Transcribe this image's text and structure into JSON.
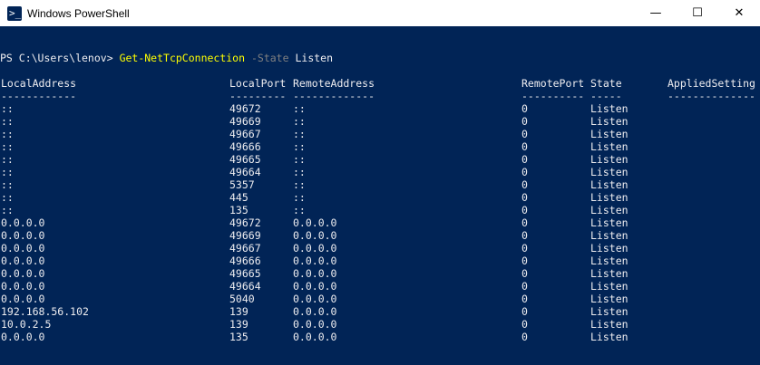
{
  "window": {
    "title": "Windows PowerShell",
    "icon_glyph": ">_",
    "minimize": "—",
    "maximize": "☐",
    "close": "✕"
  },
  "console": {
    "prompt": "PS C:\\Users\\lenov> ",
    "command": "Get-NetTcpConnection",
    "param": "-State",
    "value": "Listen",
    "headers": [
      "LocalAddress",
      "LocalPort",
      "RemoteAddress",
      "RemotePort",
      "State",
      "AppliedSetting"
    ],
    "underlines": [
      "------------",
      "---------",
      "-------------",
      "----------",
      "-----",
      "--------------"
    ],
    "rows": [
      [
        "::",
        "49672",
        "::",
        "0",
        "Listen",
        ""
      ],
      [
        "::",
        "49669",
        "::",
        "0",
        "Listen",
        ""
      ],
      [
        "::",
        "49667",
        "::",
        "0",
        "Listen",
        ""
      ],
      [
        "::",
        "49666",
        "::",
        "0",
        "Listen",
        ""
      ],
      [
        "::",
        "49665",
        "::",
        "0",
        "Listen",
        ""
      ],
      [
        "::",
        "49664",
        "::",
        "0",
        "Listen",
        ""
      ],
      [
        "::",
        "5357",
        "::",
        "0",
        "Listen",
        ""
      ],
      [
        "::",
        "445",
        "::",
        "0",
        "Listen",
        ""
      ],
      [
        "::",
        "135",
        "::",
        "0",
        "Listen",
        ""
      ],
      [
        "0.0.0.0",
        "49672",
        "0.0.0.0",
        "0",
        "Listen",
        ""
      ],
      [
        "0.0.0.0",
        "49669",
        "0.0.0.0",
        "0",
        "Listen",
        ""
      ],
      [
        "0.0.0.0",
        "49667",
        "0.0.0.0",
        "0",
        "Listen",
        ""
      ],
      [
        "0.0.0.0",
        "49666",
        "0.0.0.0",
        "0",
        "Listen",
        ""
      ],
      [
        "0.0.0.0",
        "49665",
        "0.0.0.0",
        "0",
        "Listen",
        ""
      ],
      [
        "0.0.0.0",
        "49664",
        "0.0.0.0",
        "0",
        "Listen",
        ""
      ],
      [
        "0.0.0.0",
        "5040",
        "0.0.0.0",
        "0",
        "Listen",
        ""
      ],
      [
        "192.168.56.102",
        "139",
        "0.0.0.0",
        "0",
        "Listen",
        ""
      ],
      [
        "10.0.2.5",
        "139",
        "0.0.0.0",
        "0",
        "Listen",
        ""
      ],
      [
        "0.0.0.0",
        "135",
        "0.0.0.0",
        "0",
        "Listen",
        ""
      ]
    ]
  },
  "colors": {
    "background": "#012456",
    "foreground": "#eeedf0",
    "command": "#ffff00",
    "parameter": "#808080"
  }
}
